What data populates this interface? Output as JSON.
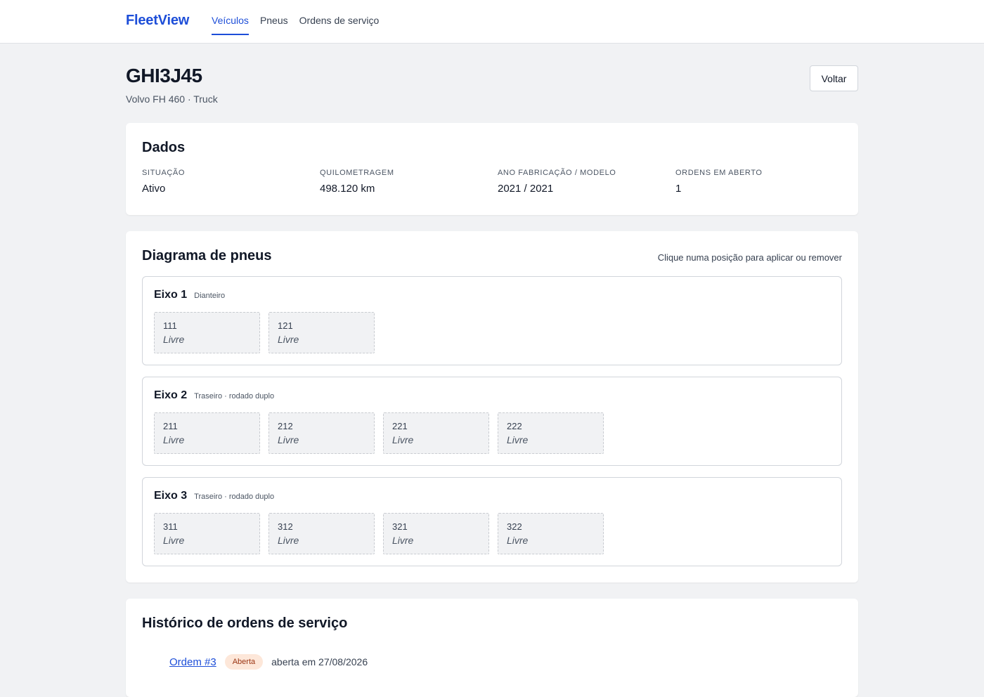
{
  "brand": "FleetView",
  "nav": [
    "Veículos",
    "Pneus",
    "Ordens de serviço"
  ],
  "vehicle": {
    "plate": "GHI3J45",
    "subtitle": "Volvo FH 460 · Truck",
    "back_label": "Voltar"
  },
  "dados": {
    "title": "Dados",
    "fields": [
      {
        "label": "SITUAÇÃO",
        "value": "Ativo"
      },
      {
        "label": "QUILOMETRAGEM",
        "value": "498.120 km"
      },
      {
        "label": "ANO FABRICAÇÃO / MODELO",
        "value": "2021 / 2021"
      },
      {
        "label": "ORDENS EM ABERTO",
        "value": "1"
      }
    ]
  },
  "diagram": {
    "title": "Diagrama de pneus",
    "hint": "Clique numa posição para aplicar ou remover",
    "axles": [
      {
        "name": "Eixo 1",
        "type": "Dianteiro",
        "slots": [
          {
            "pos": "111",
            "state": "Livre"
          },
          {
            "pos": "121",
            "state": "Livre"
          }
        ]
      },
      {
        "name": "Eixo 2",
        "type": "Traseiro · rodado duplo",
        "slots": [
          {
            "pos": "211",
            "state": "Livre"
          },
          {
            "pos": "212",
            "state": "Livre"
          },
          {
            "pos": "221",
            "state": "Livre"
          },
          {
            "pos": "222",
            "state": "Livre"
          }
        ]
      },
      {
        "name": "Eixo 3",
        "type": "Traseiro · rodado duplo",
        "slots": [
          {
            "pos": "311",
            "state": "Livre"
          },
          {
            "pos": "312",
            "state": "Livre"
          },
          {
            "pos": "321",
            "state": "Livre"
          },
          {
            "pos": "322",
            "state": "Livre"
          }
        ]
      }
    ]
  },
  "history": {
    "title": "Histórico de ordens de serviço",
    "orders": [
      {
        "label": "Ordem #3",
        "status": "Aberta",
        "meta": "aberta em 27/08/2026"
      }
    ]
  }
}
